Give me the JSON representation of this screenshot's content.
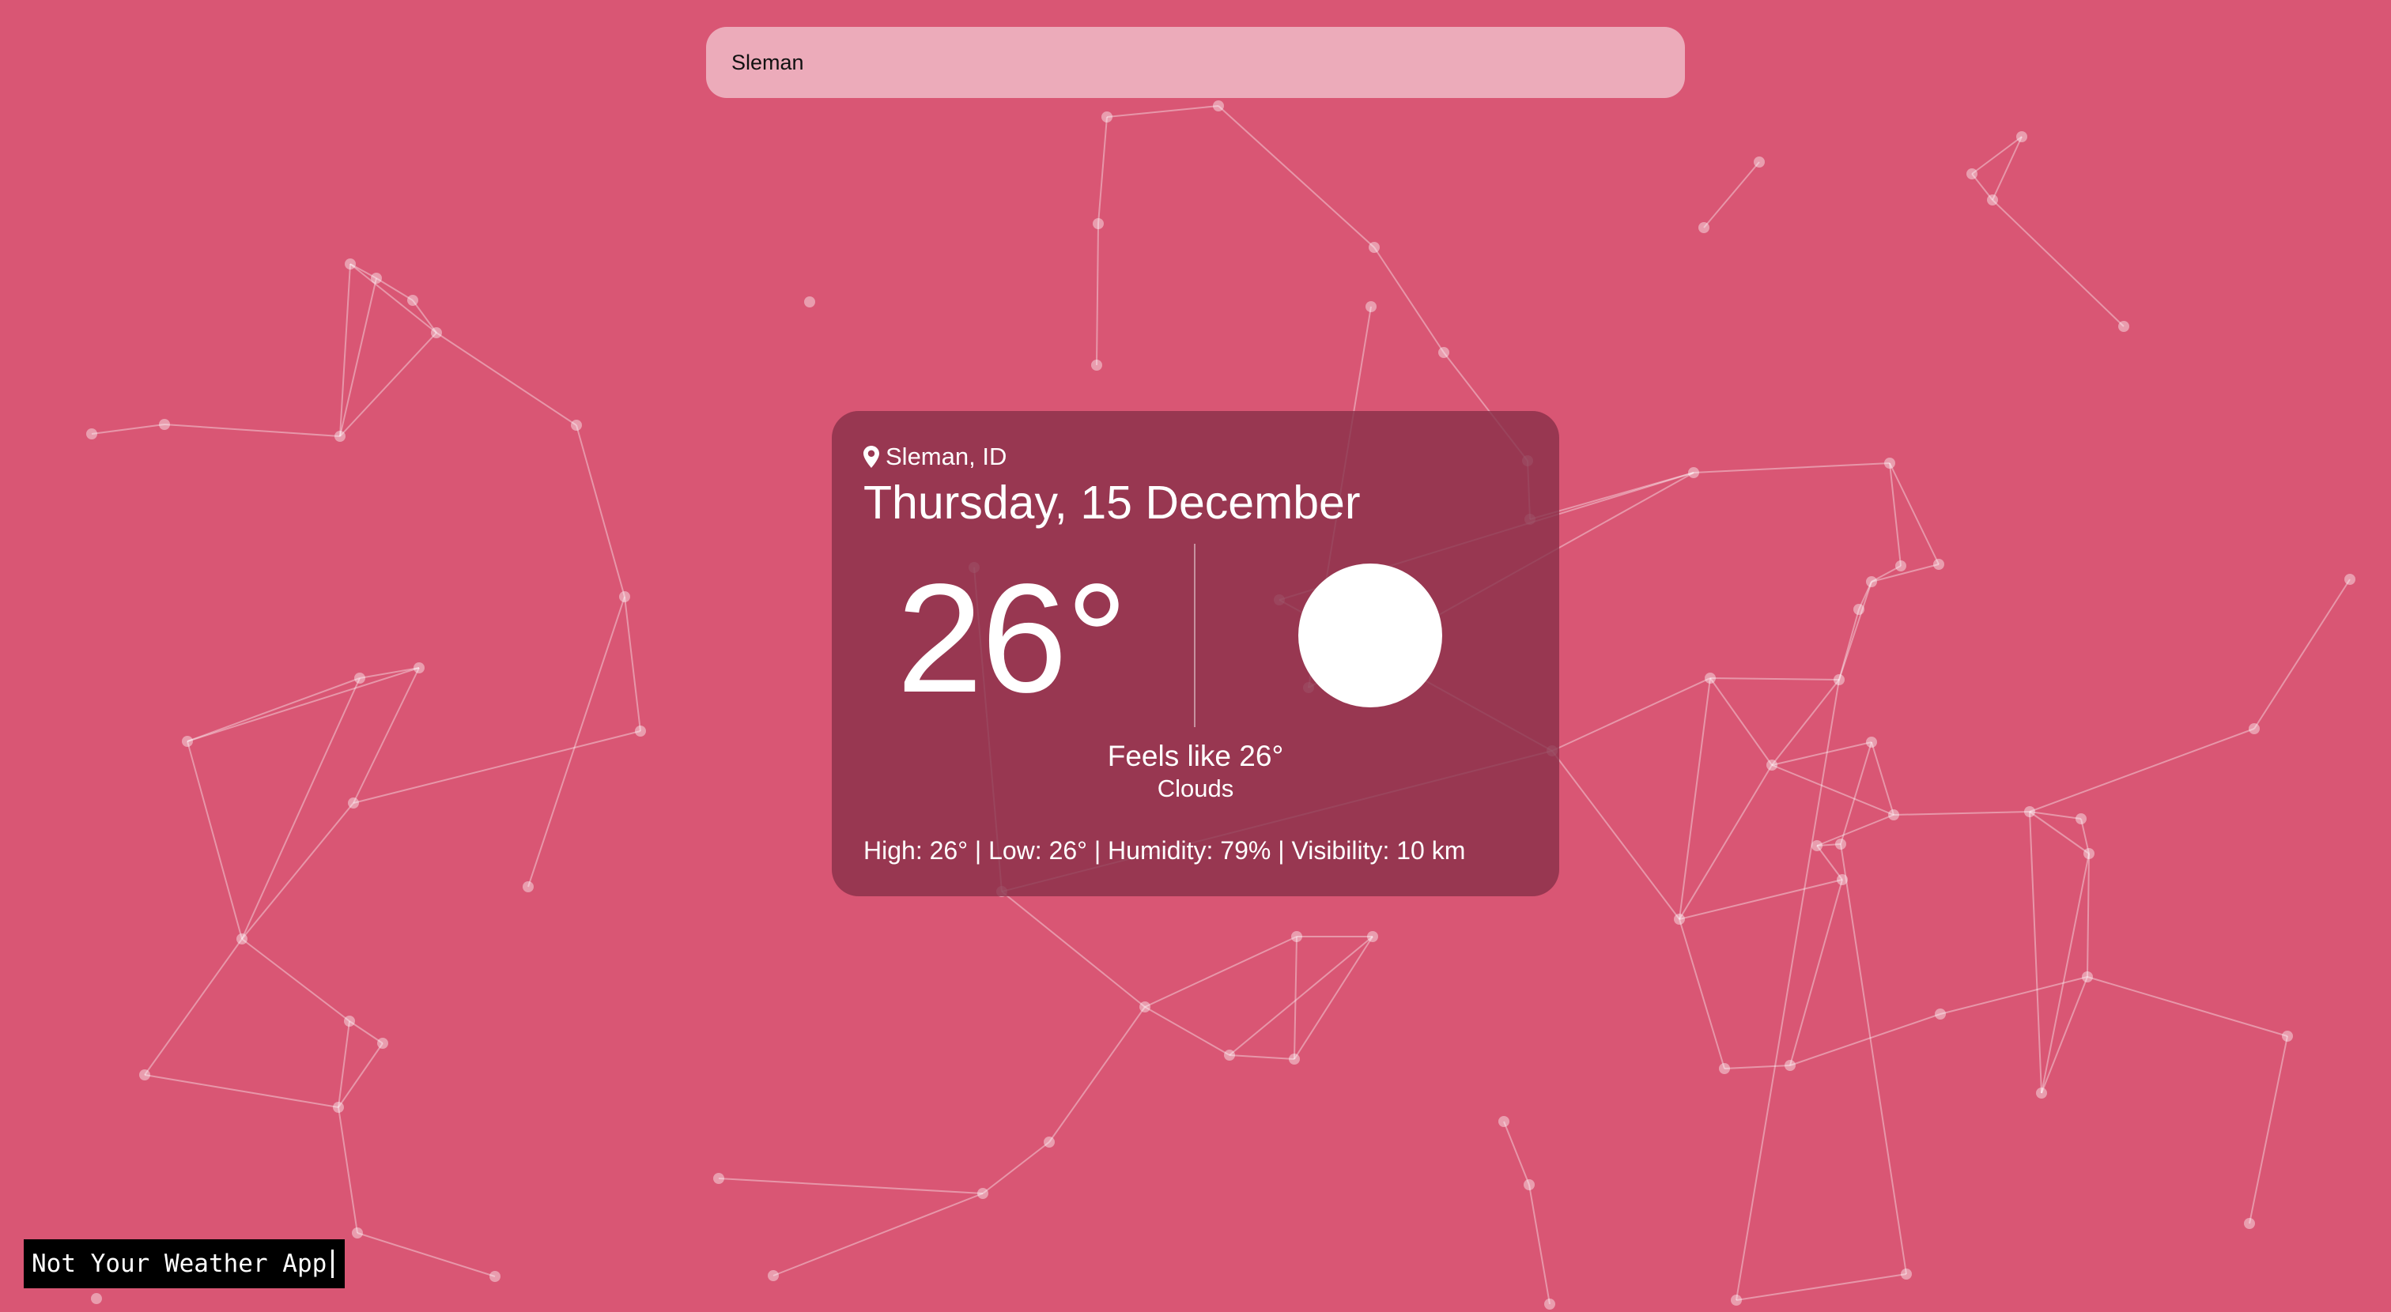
{
  "search": {
    "value": "Sleman",
    "placeholder": ""
  },
  "weather": {
    "location": "Sleman, ID",
    "date": "Thursday, 15 December",
    "temperature": "26°",
    "feels_like": "Feels like 26°",
    "condition": "Clouds",
    "stats": "High: 26° | Low: 26° | Humidity: 79% | Visibility: 10 km"
  },
  "footer": {
    "app_name": "Not Your Weather App"
  },
  "icons": {
    "location": "map-pin-icon",
    "weather": "sun-icon"
  },
  "colors": {
    "background": "#d95674",
    "card": "#872f48",
    "text": "#ffffff"
  }
}
